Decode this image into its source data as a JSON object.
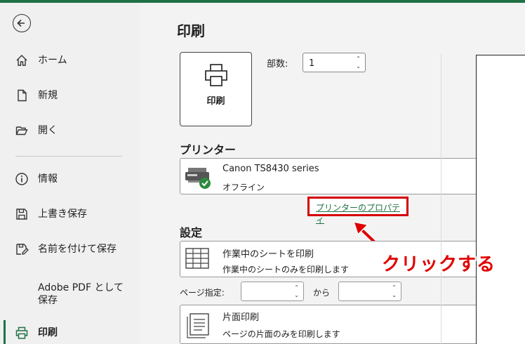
{
  "nav": {
    "items": [
      {
        "label": "ホーム",
        "icon": "home-icon"
      },
      {
        "label": "新規",
        "icon": "new-document-icon"
      },
      {
        "label": "開く",
        "icon": "folder-open-icon"
      },
      {
        "label": "情報",
        "icon": "info-icon"
      },
      {
        "label": "上書き保存",
        "icon": "save-icon"
      },
      {
        "label": "名前を付けて保存",
        "icon": "save-as-icon"
      },
      {
        "label": "Adobe PDF として保存",
        "icon": ""
      },
      {
        "label": "印刷",
        "icon": "printer-icon"
      }
    ],
    "active": "印刷"
  },
  "title": "印刷",
  "print_button": {
    "label": "印刷"
  },
  "copies": {
    "label": "部数:",
    "value": "1"
  },
  "printer": {
    "heading": "プリンター",
    "name": "Canon TS8430 series",
    "status": "オフライン",
    "properties_link": "プリンターのプロパティ"
  },
  "settings": {
    "heading": "設定",
    "scope": {
      "title": "作業中のシートを印刷",
      "desc": "作業中のシートのみを印刷します"
    },
    "pages_label": "ページ指定:",
    "pages_to": "から",
    "sides": {
      "title": "片面印刷",
      "desc": "ページの片面のみを印刷します"
    }
  },
  "annotation": {
    "text": "クリックする",
    "color": "#e00000"
  },
  "colors": {
    "accent": "#1e7145",
    "highlight": "#d40000"
  }
}
